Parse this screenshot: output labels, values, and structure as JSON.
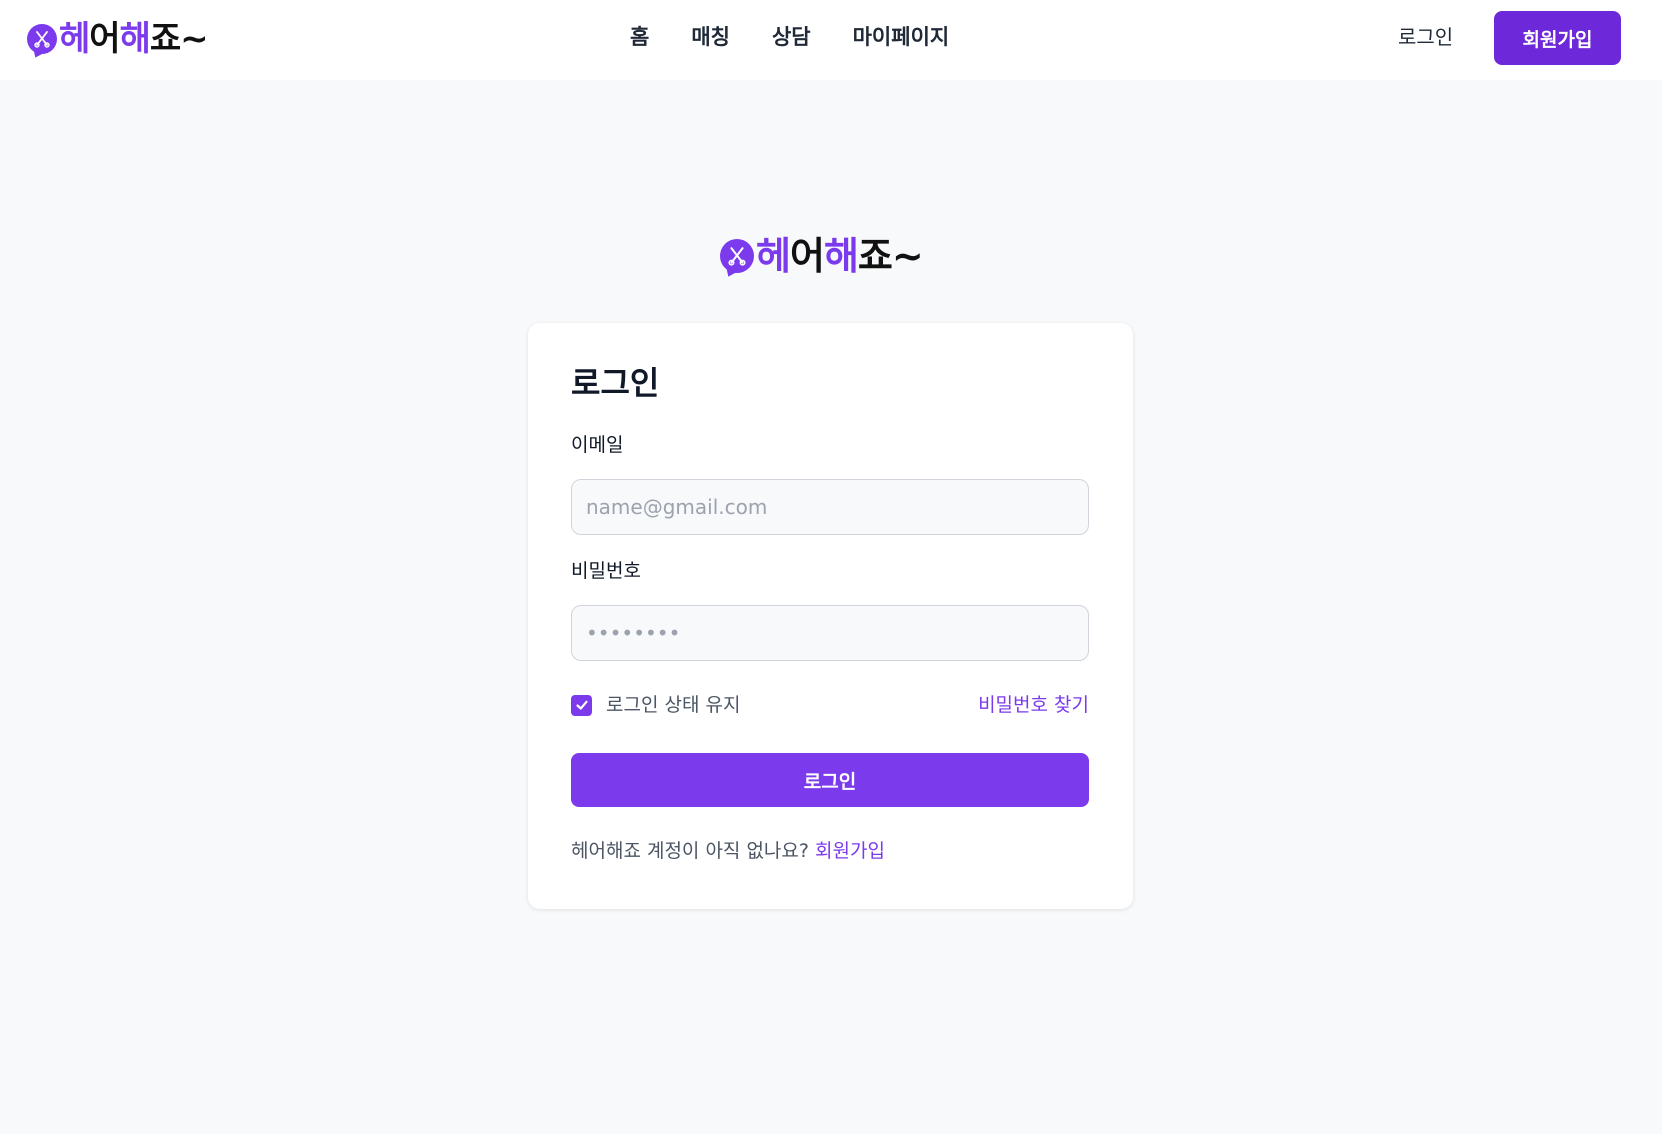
{
  "header": {
    "logo": {
      "parts": [
        "헤",
        "어",
        "해",
        "죠~"
      ]
    },
    "nav": [
      "홈",
      "매칭",
      "상담",
      "마이페이지"
    ],
    "login_label": "로그인",
    "signup_label": "회원가입"
  },
  "center_logo": {
    "parts": [
      "헤",
      "어",
      "해",
      "죠~"
    ]
  },
  "card": {
    "title": "로그인",
    "email_label": "이메일",
    "email_placeholder": "name@gmail.com",
    "email_value": "",
    "password_label": "비밀번호",
    "password_placeholder": "••••••••",
    "password_value": "",
    "remember_label": "로그인 상태 유지",
    "remember_checked": true,
    "find_password_label": "비밀번호 찾기",
    "login_button_label": "로그인",
    "signup_prompt": "헤어해죠 계정이 아직 없나요?",
    "signup_link_label": "회원가입"
  },
  "colors": {
    "accent": "#7c3aed",
    "accent_dark": "#6d28d9",
    "background": "#f8f9fa"
  },
  "icons": {
    "logo_mark": "scissors-icon",
    "checkbox": "check-icon"
  }
}
